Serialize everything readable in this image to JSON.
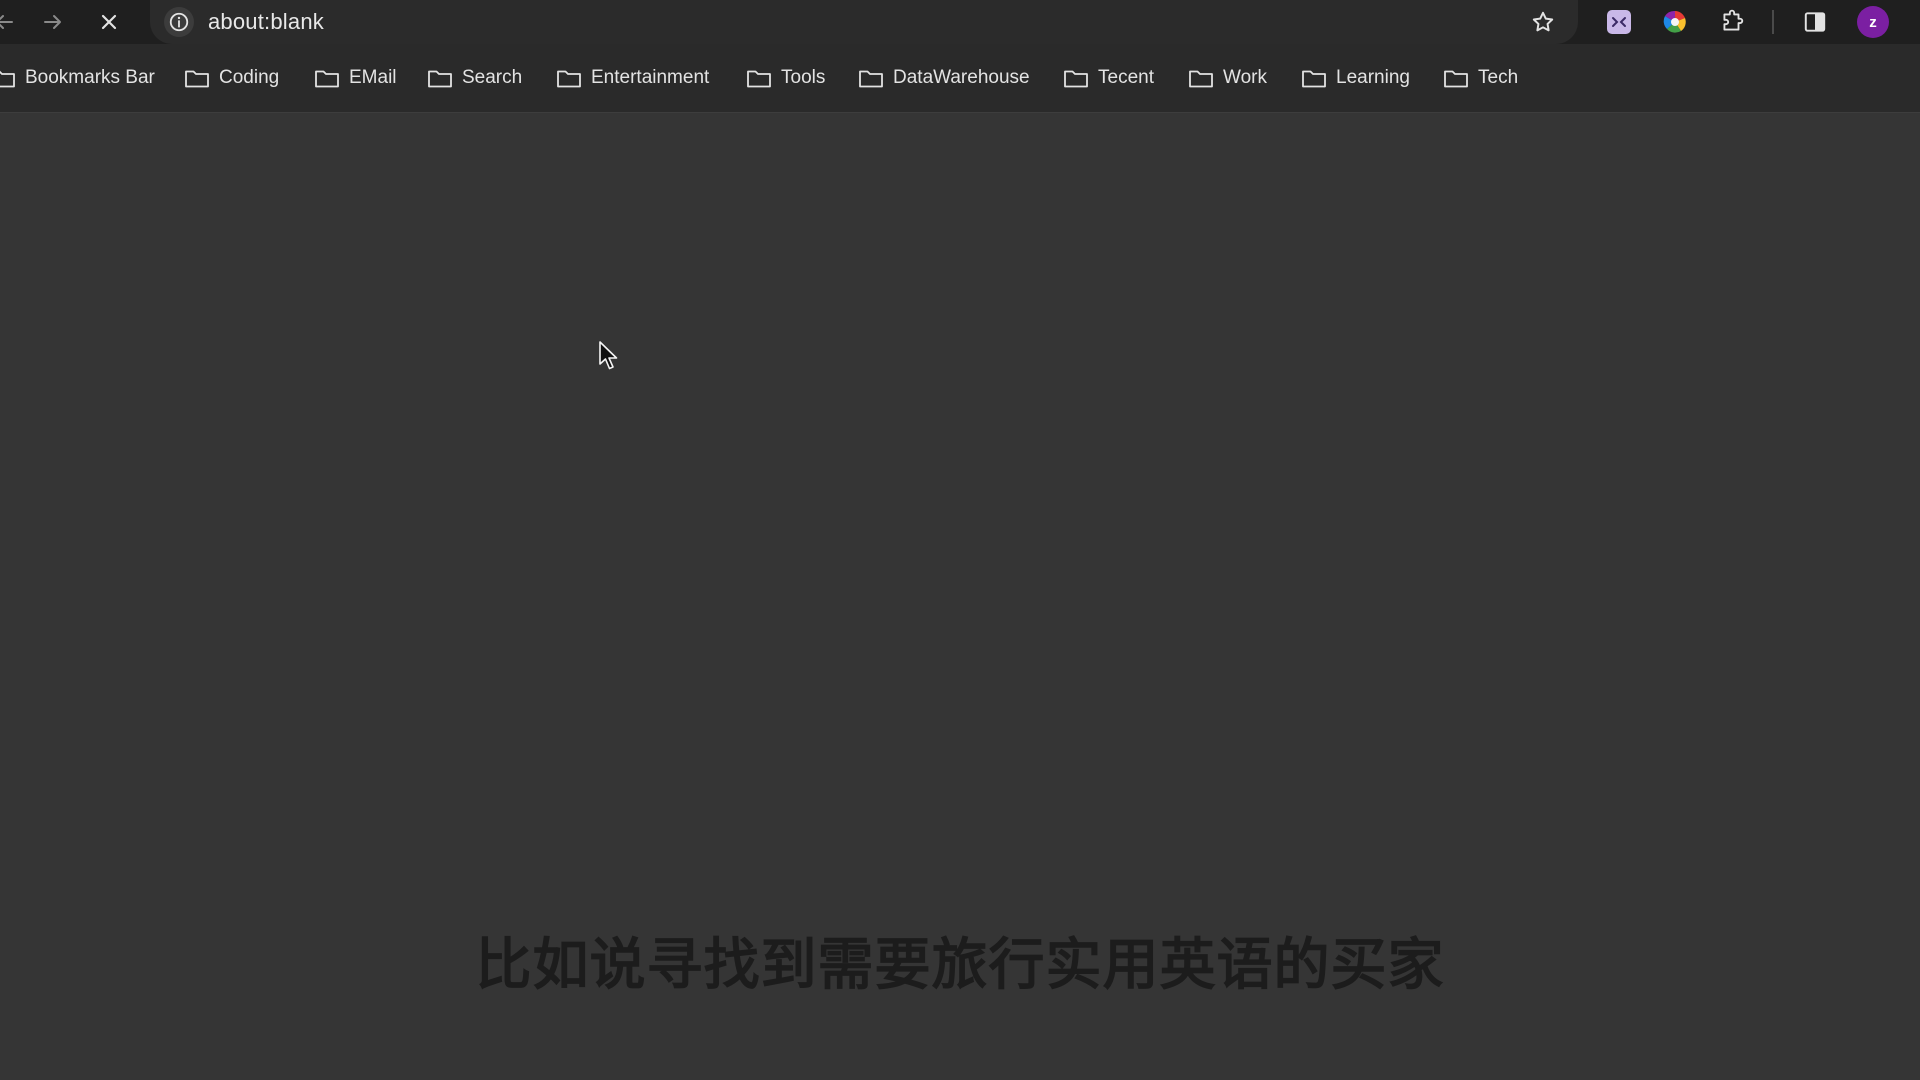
{
  "browser": {
    "address_bar": {
      "url": "about:blank"
    },
    "avatar_letter": "z"
  },
  "bookmarks_bar": {
    "items": [
      {
        "label": "Bookmarks Bar"
      },
      {
        "label": "Coding"
      },
      {
        "label": "EMail"
      },
      {
        "label": "Search"
      },
      {
        "label": "Entertainment"
      },
      {
        "label": "Tools"
      },
      {
        "label": "DataWarehouse"
      },
      {
        "label": "Tecent"
      },
      {
        "label": "Work"
      },
      {
        "label": "Learning"
      },
      {
        "label": "Tech"
      }
    ]
  },
  "subtitle": {
    "text": "比如说寻找到需要旅行实用英语的买家"
  },
  "colors": {
    "toolbar_bg": "#1f1f1f",
    "bookmarks_bg": "#2a2a2a",
    "page_bg": "#353535",
    "avatar": "#7b1fa2"
  },
  "icons": [
    "back-arrow-icon",
    "forward-arrow-icon",
    "stop-loading-icon",
    "info-icon",
    "star-icon",
    "translate-extension-icon",
    "color-extension-icon",
    "puzzle-extensions-icon",
    "side-panel-icon",
    "folder-icon",
    "mouse-cursor-icon"
  ]
}
